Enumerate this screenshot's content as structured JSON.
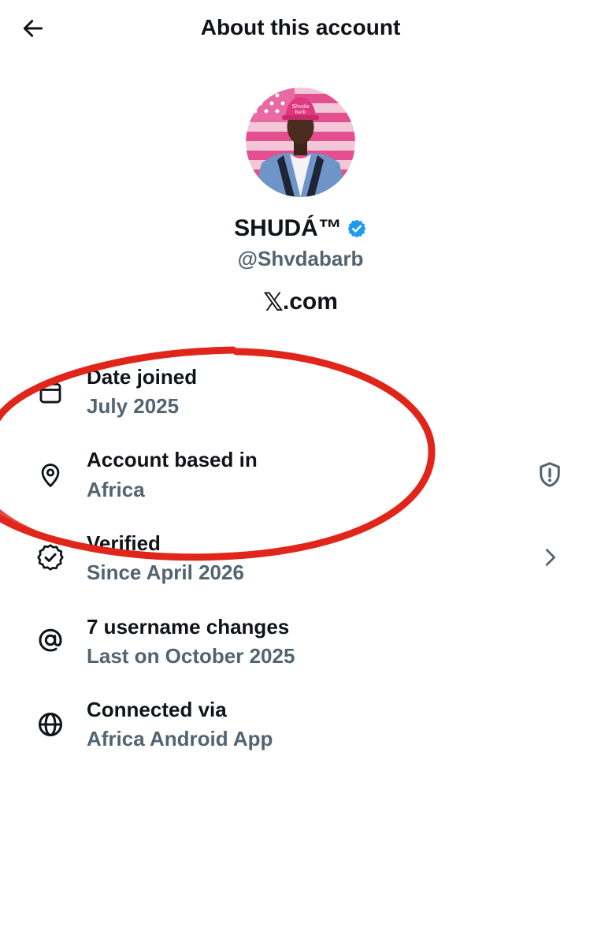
{
  "header": {
    "title": "About this account",
    "back_icon": "arrow-left-icon"
  },
  "profile": {
    "display_name": "SHUDÁ™",
    "verified_badge_color": "#1d9bf0",
    "handle": "@Shvdabarb",
    "site_logo": "𝕏",
    "site_domain": ".com"
  },
  "items": [
    {
      "icon": "calendar-icon",
      "title": "Date joined",
      "subtitle": "July 2025"
    },
    {
      "icon": "location-pin-icon",
      "title": "Account based in",
      "subtitle": "Africa",
      "trailing_icon": "shield-alert-icon"
    },
    {
      "icon": "verified-badge-icon",
      "title": "Verified",
      "subtitle": "Since April 2026",
      "trailing_icon": "chevron-right-icon"
    },
    {
      "icon": "at-sign-icon",
      "title": "7 username changes",
      "subtitle": "Last on October 2025"
    },
    {
      "icon": "globe-icon",
      "title": "Connected via",
      "subtitle": "Africa Android App"
    }
  ],
  "colors": {
    "text_primary": "#0f1419",
    "text_secondary": "#536471",
    "annotation_red": "#e0261b"
  }
}
